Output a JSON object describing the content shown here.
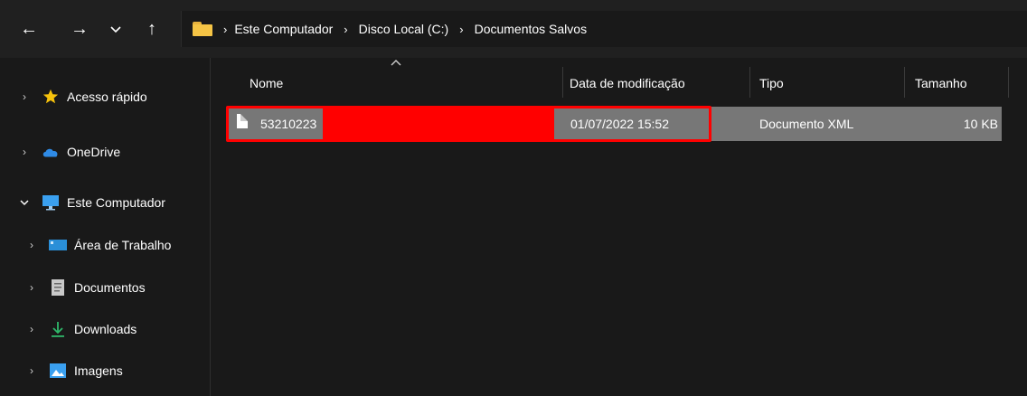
{
  "nav": {
    "back_glyph": "←",
    "forward_glyph": "→",
    "recent_glyph": "⌄",
    "up_glyph": "↑"
  },
  "breadcrumb": {
    "separator": "›",
    "items": [
      "Este Computador",
      "Disco Local (C:)",
      "Documentos Salvos"
    ]
  },
  "sidebar": {
    "items": [
      {
        "label": "Acesso rápido",
        "icon": "star-icon",
        "expanded": false
      },
      {
        "label": "OneDrive",
        "icon": "cloud-icon",
        "expanded": false
      },
      {
        "label": "Este Computador",
        "icon": "computer-icon",
        "expanded": true
      },
      {
        "label": "Área de Trabalho",
        "icon": "desktop-icon",
        "expanded": false
      },
      {
        "label": "Documentos",
        "icon": "document-icon",
        "expanded": false
      },
      {
        "label": "Downloads",
        "icon": "download-icon",
        "expanded": false
      },
      {
        "label": "Imagens",
        "icon": "pictures-icon",
        "expanded": false
      }
    ],
    "chevron_collapsed": "›",
    "chevron_expanded": "⌄"
  },
  "columns": {
    "name": "Nome",
    "date": "Data de modificação",
    "type": "Tipo",
    "size": "Tamanho",
    "sort_caret": "^"
  },
  "files": [
    {
      "name": "53210223",
      "date": "01/07/2022 15:52",
      "type": "Documento XML",
      "size": "10 KB"
    }
  ],
  "colors": {
    "background": "#191919",
    "selected_row": "#777777",
    "redaction": "#ff0000",
    "folder": "#f5c445"
  }
}
